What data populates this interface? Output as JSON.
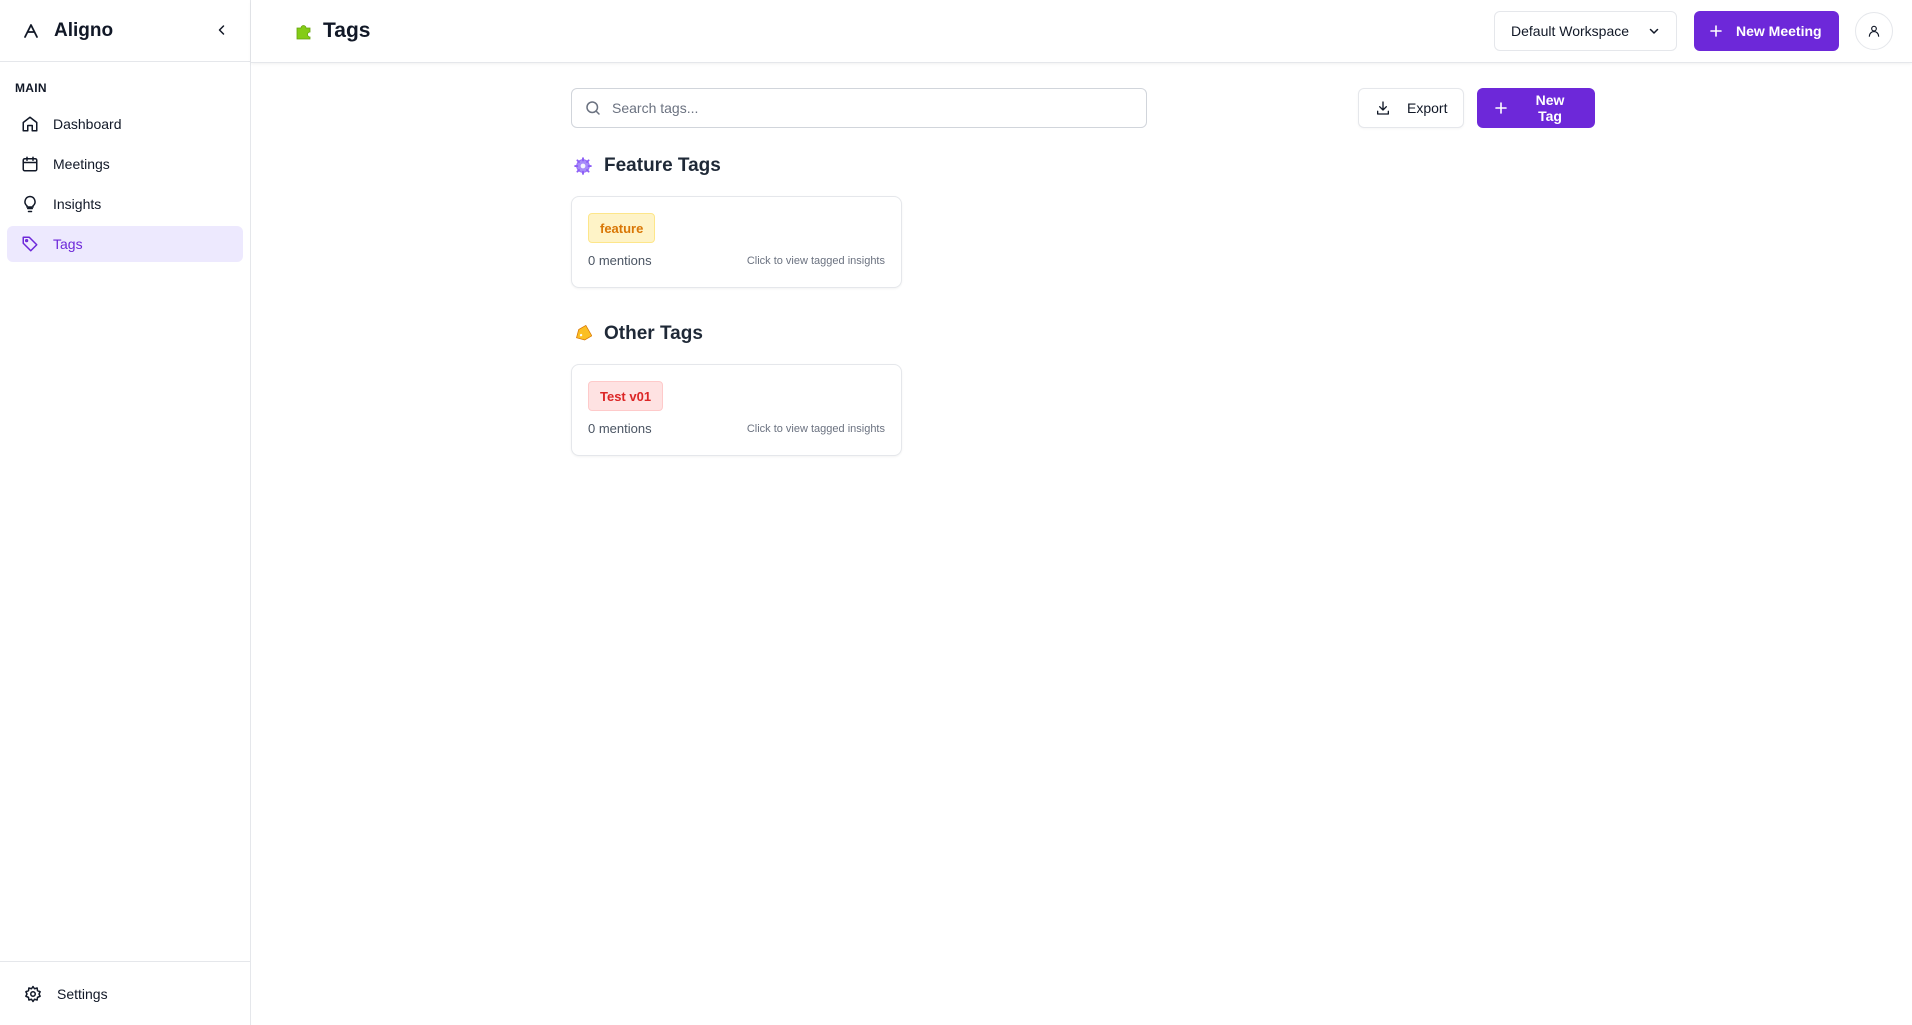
{
  "app": {
    "name": "Aligno",
    "accent_color": "#6d28d9"
  },
  "sidebar": {
    "section_label": "MAIN",
    "items": [
      {
        "label": "Dashboard",
        "icon": "home-icon"
      },
      {
        "label": "Meetings",
        "icon": "calendar-icon"
      },
      {
        "label": "Insights",
        "icon": "lightbulb-icon"
      },
      {
        "label": "Tags",
        "icon": "tag-icon",
        "active": true
      }
    ],
    "footer": {
      "label": "Settings",
      "icon": "gear-icon"
    }
  },
  "header": {
    "title": "Tags",
    "title_icon": "puzzle-piece-icon",
    "workspace": "Default Workspace",
    "new_meeting_label": "New Meeting"
  },
  "toolbar": {
    "search_placeholder": "Search tags...",
    "search_value": "",
    "export_label": "Export",
    "new_tag_label": "New Tag"
  },
  "sections": [
    {
      "title": "Feature Tags",
      "icon": "gear-emoji-icon",
      "tags": [
        {
          "name": "feature",
          "mentions": "0 mentions",
          "hint": "Click to view tagged insights",
          "color": "#d97706"
        }
      ]
    },
    {
      "title": "Other Tags",
      "icon": "label-emoji-icon",
      "tags": [
        {
          "name": "Test v01",
          "mentions": "0 mentions",
          "hint": "Click to view tagged insights",
          "color": "#dc2626"
        }
      ]
    }
  ]
}
